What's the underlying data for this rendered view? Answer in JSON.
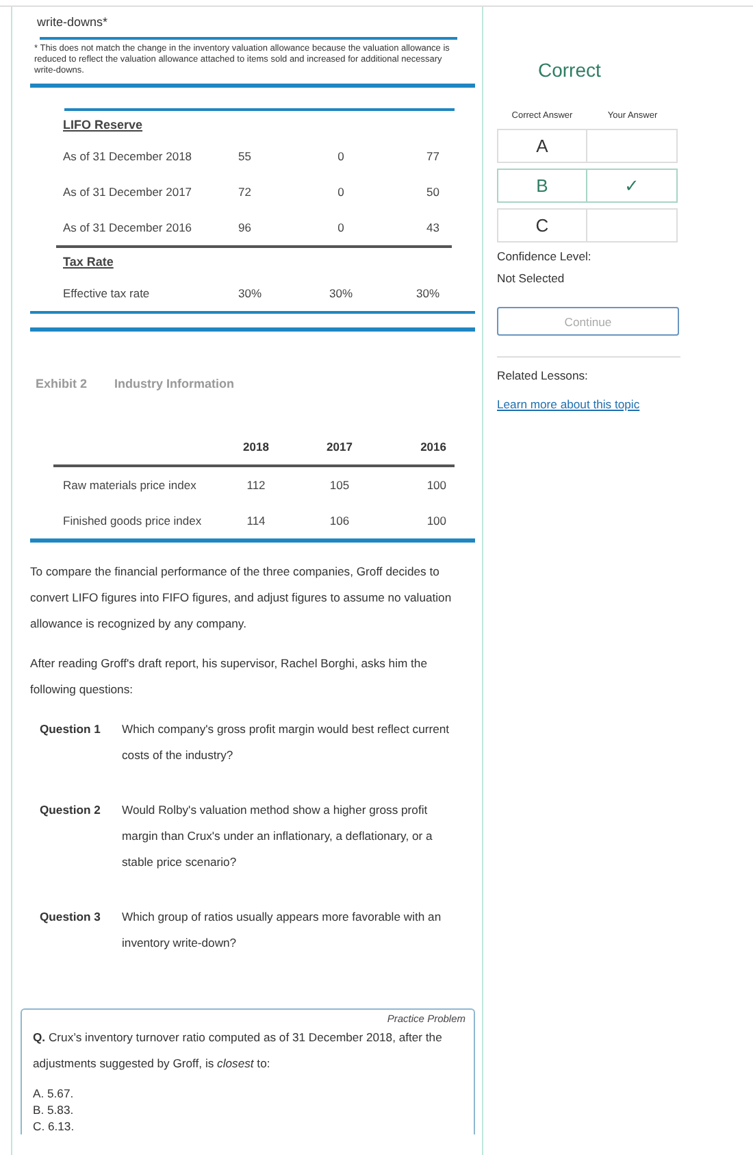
{
  "exhibit1": {
    "footnote_ref": "write-downs*",
    "footnote": "* This does not match the change in the inventory valuation allowance because the valuation allowance is reduced to reflect the valuation allowance attached to items sold and increased for additional necessary write-downs.",
    "lifo": {
      "heading": "LIFO Reserve",
      "rows": [
        {
          "label": "As of 31 December 2018",
          "values": [
            "55",
            "0",
            "77"
          ]
        },
        {
          "label": "As of 31 December 2017",
          "values": [
            "72",
            "0",
            "50"
          ]
        },
        {
          "label": "As of 31 December 2016",
          "values": [
            "96",
            "0",
            "43"
          ]
        }
      ]
    },
    "tax": {
      "heading": "Tax Rate",
      "rows": [
        {
          "label": "Effective tax rate",
          "values": [
            "30%",
            "30%",
            "30%"
          ]
        }
      ]
    }
  },
  "exhibit2": {
    "number": "Exhibit 2",
    "title": "Industry Information",
    "columns": [
      "2018",
      "2017",
      "2016"
    ],
    "rows": [
      {
        "label": "Raw materials price index",
        "values": [
          "112",
          "105",
          "100"
        ]
      },
      {
        "label": "Finished goods price index",
        "values": [
          "114",
          "106",
          "100"
        ]
      }
    ]
  },
  "paragraphs": [
    "To compare the financial performance of the three companies, Groff decides to convert LIFO figures into FIFO figures, and adjust figures to assume no valuation allowance is recognized by any company.",
    "After reading Groff's draft report, his supervisor, Rachel Borghi, asks him the following questions:"
  ],
  "questions": [
    {
      "number": "Question 1",
      "text": "Which company's gross profit margin would best reflect current costs of the industry?"
    },
    {
      "number": "Question 2",
      "text": "Would Rolby's valuation method show a higher gross profit margin than Crux's under an inflationary, a deflationary, or a stable price scenario?"
    },
    {
      "number": "Question 3",
      "text": "Which group of ratios usually appears more favorable with an inventory write-down?"
    }
  ],
  "practice": {
    "tag": "Practice Problem",
    "prompt": "**Q.** Crux’s inventory turnover ratio computed as of 31 December 2018, after the adjustments suggested by Groff, is *closest* to:",
    "options": [
      "A. 5.67.",
      "B. 5.83.",
      "C. 6.13."
    ]
  },
  "result": {
    "status": "Correct",
    "columns": [
      "Correct Answer",
      "Your Answer"
    ],
    "check": "✓",
    "options": [
      {
        "letter": "A",
        "correct": false,
        "chosen": false
      },
      {
        "letter": "B",
        "correct": true,
        "chosen": true
      },
      {
        "letter": "C",
        "correct": false,
        "chosen": false
      }
    ],
    "confidence_label": "Confidence Level:",
    "confidence": "Not Selected",
    "continue": {
      "label": "Continue",
      "disabled": true
    },
    "related_label": "Related Lessons:",
    "related_link": "Learn more about this topic"
  }
}
